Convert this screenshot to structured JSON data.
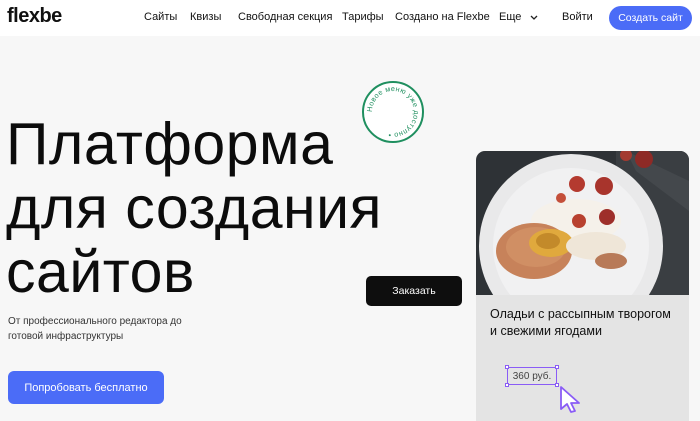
{
  "header": {
    "logo": "flexbe",
    "nav": [
      "Сайты",
      "Квизы",
      "Свободная секция",
      "Тарифы",
      "Создано на Flexbe",
      "Еще"
    ],
    "login_label": "Войти",
    "create_label": "Создать сайт"
  },
  "hero": {
    "title_lines": [
      "Платформа",
      "для создания",
      "сайтов"
    ],
    "subtitle": "От профессионального редактора до готовой инфраструктуры",
    "try_label": "Попробовать бесплатно",
    "badge_text": "Новое меню уже доступно •"
  },
  "order_label": "Заказать",
  "card": {
    "title": "Оладьи с рассыпным творогом и свежими ягодами",
    "price": "360 руб."
  },
  "colors": {
    "accent": "#4b6cf7",
    "badge_green": "#1f8f5f",
    "selection": "#8a5cf6",
    "background": "#f7f7f7"
  },
  "icons": [
    "chevron-down-icon",
    "pointer-cursor-icon"
  ]
}
